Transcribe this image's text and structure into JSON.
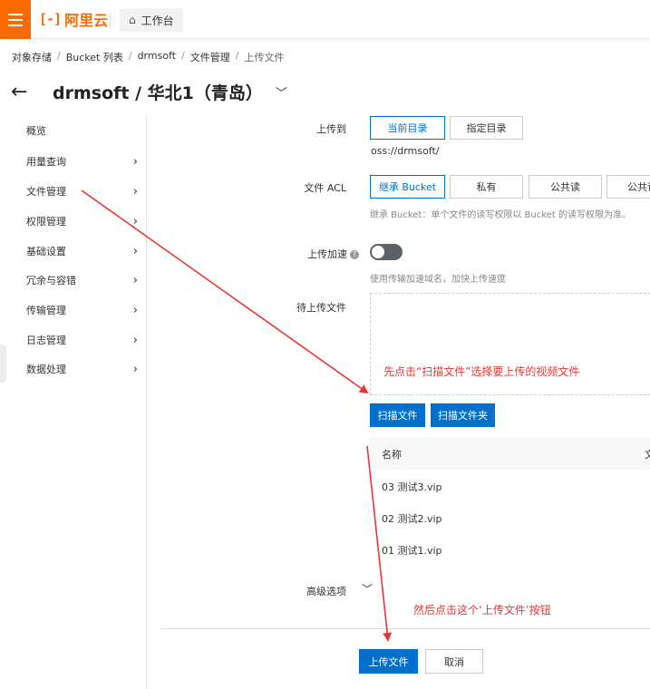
{
  "header": {
    "logo_mark": "[-]",
    "logo_text": "阿里云",
    "workbench_label": "工作台"
  },
  "breadcrumb": [
    "对象存储",
    "Bucket 列表",
    "drmsoft",
    "文件管理",
    "上传文件"
  ],
  "page_title": "drmsoft / 华北1（青岛）",
  "sidebar": {
    "items": [
      {
        "label": "概览",
        "has_chevron": false
      },
      {
        "label": "用量查询",
        "has_chevron": true
      },
      {
        "label": "文件管理",
        "has_chevron": true
      },
      {
        "label": "权限管理",
        "has_chevron": true
      },
      {
        "label": "基础设置",
        "has_chevron": true
      },
      {
        "label": "冗余与容错",
        "has_chevron": true
      },
      {
        "label": "传输管理",
        "has_chevron": true
      },
      {
        "label": "日志管理",
        "has_chevron": true
      },
      {
        "label": "数据处理",
        "has_chevron": true
      }
    ]
  },
  "form": {
    "upload_to": {
      "label": "上传到",
      "options": [
        "当前目录",
        "指定目录"
      ],
      "selected": "当前目录",
      "path": "oss://drmsoft/"
    },
    "acl": {
      "label": "文件 ACL",
      "options": [
        "继承 Bucket",
        "私有",
        "公共读",
        "公共读"
      ],
      "selected": "继承 Bucket",
      "hint": "继承 Bucket：单个文件的读写权限以 Bucket 的读写权限为准。"
    },
    "acceleration": {
      "label": "上传加速",
      "help": "?",
      "enabled": false,
      "hint": "使用传输加速域名，加快上传速度"
    },
    "pending_files": {
      "label": "待上传文件",
      "scan_files_button": "扫描文件",
      "scan_folder_button": "扫描文件夹",
      "table": {
        "columns": [
          "名称",
          "文"
        ],
        "rows": [
          "03 测试3.vip",
          "02 测试2.vip",
          "01 测试1.vip"
        ]
      }
    },
    "advanced": {
      "label": "高级选项"
    }
  },
  "footer": {
    "upload_button": "上传文件",
    "cancel_button": "取消"
  },
  "annotations": {
    "note1": "先点击“扫描文件”选择要上传的视频文件",
    "note2": "然后点击这个‘上传文件’按钮",
    "color": "#e53935"
  },
  "colors": {
    "brand": "#ff6a00",
    "primary": "#0070cc"
  }
}
